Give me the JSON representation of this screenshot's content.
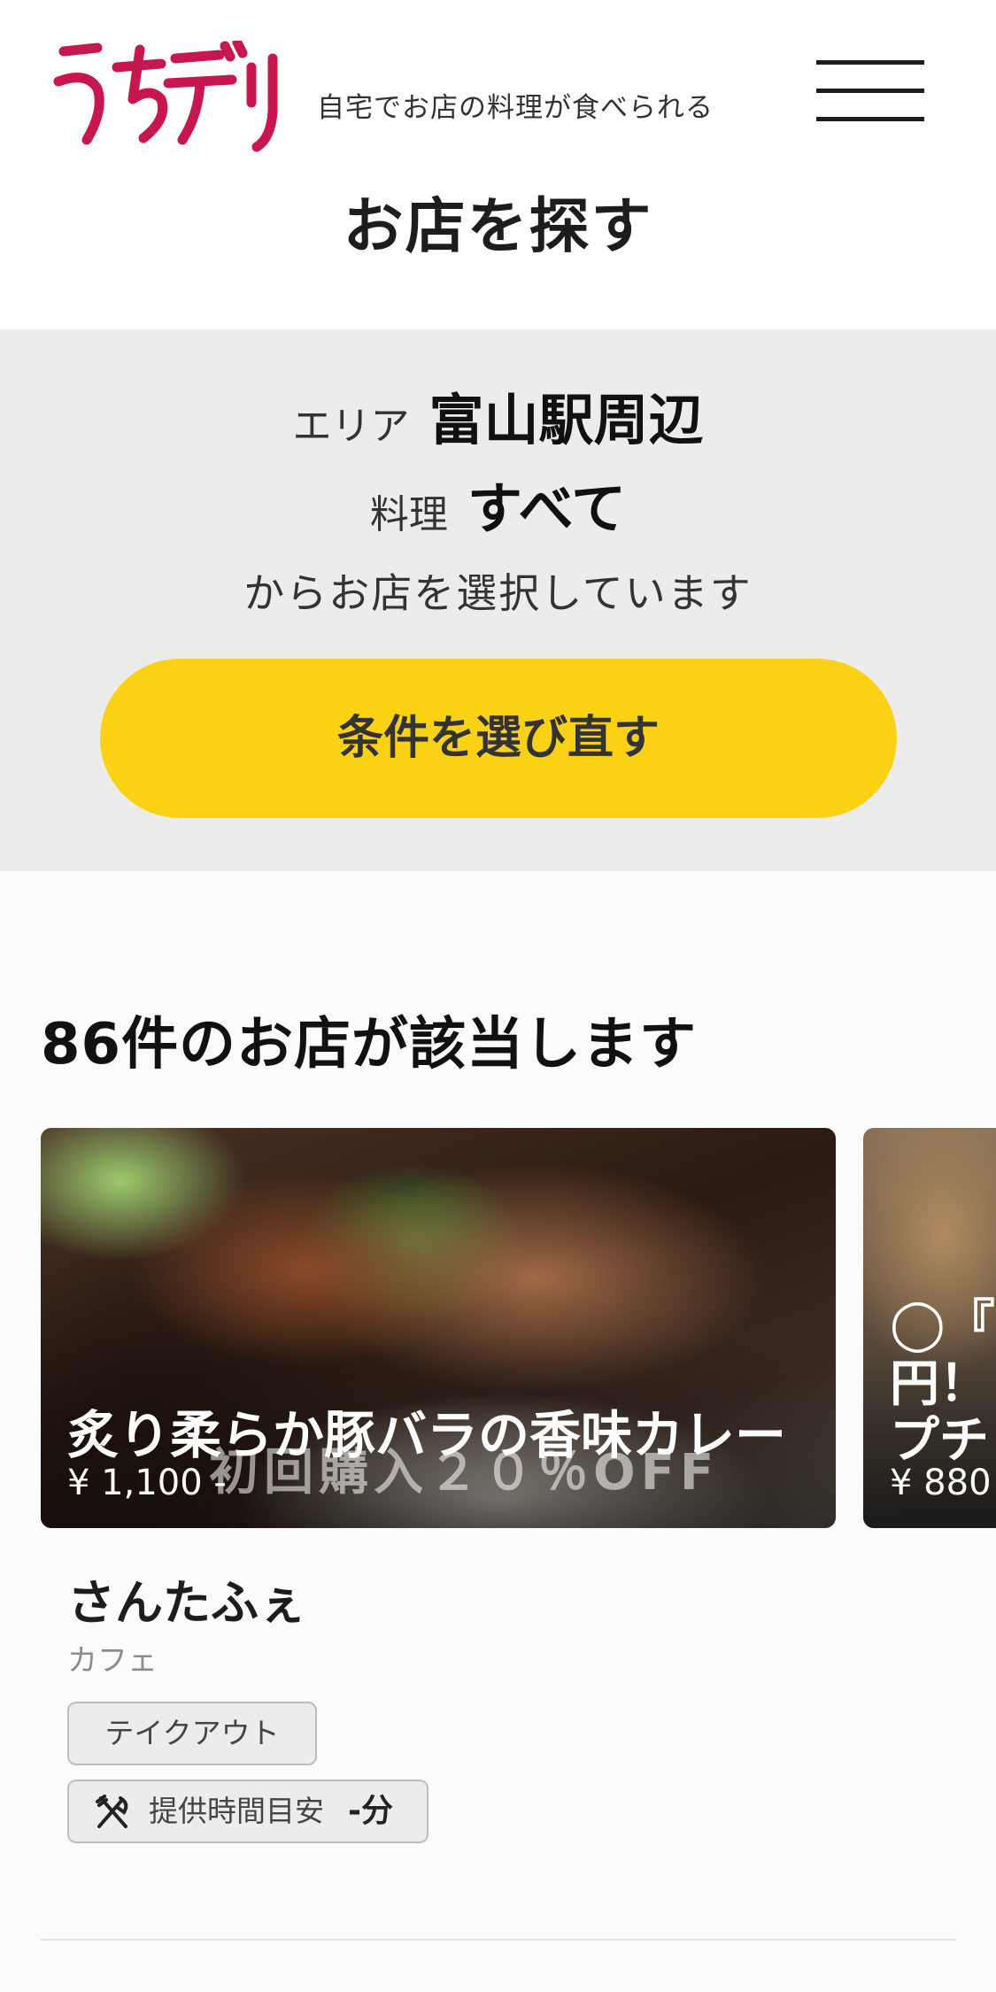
{
  "header": {
    "logo_text": "うちデリ",
    "tagline": "自宅でお店の料理が食べられる",
    "menu_icon": "hamburger-menu-icon",
    "brand_color": "#c8174f"
  },
  "page_title": "お店を探す",
  "filter": {
    "area_label": "エリア",
    "area_value": "富山駅周辺",
    "cuisine_label": "料理",
    "cuisine_value": "すべて",
    "note": "からお店を選択しています",
    "reselect_label": "条件を選び直す",
    "button_color": "#fbd113"
  },
  "results": {
    "count_text": "86件のお店が該当します"
  },
  "cards": [
    {
      "dish": "炙り柔らか豚バラの香味カレー",
      "price": "¥ 1,100 -",
      "promo_overlay": "初回購入２０％OFF",
      "shop_name": "さんたふぇ",
      "category": "カフェ",
      "tags": [
        "テイクアウト"
      ],
      "time_icon": "fork-knife-icon",
      "time_label": "提供時間目安",
      "time_value": "-分"
    },
    {
      "dish_line1": "◯『",
      "dish_line2": "円！",
      "dish_line3": "プチ",
      "price": "¥ 880"
    }
  ]
}
